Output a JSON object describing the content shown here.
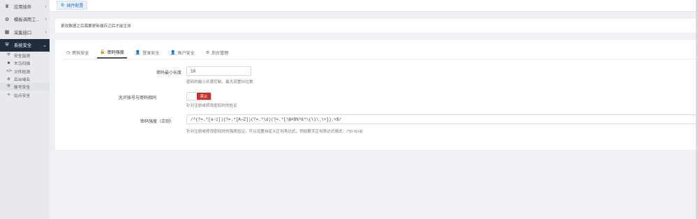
{
  "sidebar": {
    "items": [
      {
        "icon": "puzzle-icon",
        "glyph": "🧩",
        "label": "应用插件",
        "caret": "‹"
      },
      {
        "icon": "gear-icon",
        "glyph": "⚙",
        "label": "模板调用工...",
        "caret": "‹"
      },
      {
        "icon": "grid-icon",
        "glyph": "▦",
        "label": "采集接口",
        "caret": "‹"
      },
      {
        "icon": "shield-icon",
        "glyph": "⛨",
        "label": "系统安全",
        "caret": "⌄"
      }
    ],
    "sub_items": [
      {
        "icon": "shield-icon",
        "glyph": "⛨",
        "label": "安全监测"
      },
      {
        "icon": "bug-icon",
        "glyph": "✹",
        "label": "木马扫描"
      },
      {
        "icon": "code-icon",
        "glyph": "</>",
        "label": "文件检测"
      },
      {
        "icon": "gear-icon",
        "glyph": "⚙",
        "label": "后台域名"
      },
      {
        "icon": "shield-icon",
        "glyph": "⛨",
        "label": "账号安全"
      },
      {
        "icon": "share-icon",
        "glyph": "⋖",
        "label": "站点安全"
      }
    ]
  },
  "topbar": {
    "tab_label": "插件配置",
    "tab_icon": "gear-icon"
  },
  "notice": {
    "text": "更改数据之后需要更新缓存之后才能生效"
  },
  "tabs": [
    {
      "icon": "clock-icon",
      "glyph": "◷",
      "label": "密码安全"
    },
    {
      "icon": "lock-icon",
      "glyph": "🔒",
      "label": "密码强度"
    },
    {
      "icon": "user-icon",
      "glyph": "👤",
      "label": "登录安全"
    },
    {
      "icon": "user-icon",
      "glyph": "👤",
      "label": "账户安全"
    },
    {
      "icon": "gear-icon",
      "glyph": "⚙",
      "label": "后台管理"
    }
  ],
  "form": {
    "min_length": {
      "label": "密码最小长度",
      "value": "10",
      "hint": "密码的最小长度控制，最大设置50位数"
    },
    "allow_same": {
      "label": "允许账号与密码相同",
      "toggle": "禁止",
      "hint": "针对注册或修改密码时的验证"
    },
    "regex": {
      "label": "密码强度（正则）",
      "value": "/^(?=.*[a-z])(?=.*[A-Z])(?=.*\\d)(?=.*[!@#$%^&*\\(\\)\\_\\+]).+$/",
      "hint": "针对注册或修改密码时的强度验证，可以设置自定义正则表达式，例如数字正则表达式格式：/^[0-9]+$/"
    }
  }
}
